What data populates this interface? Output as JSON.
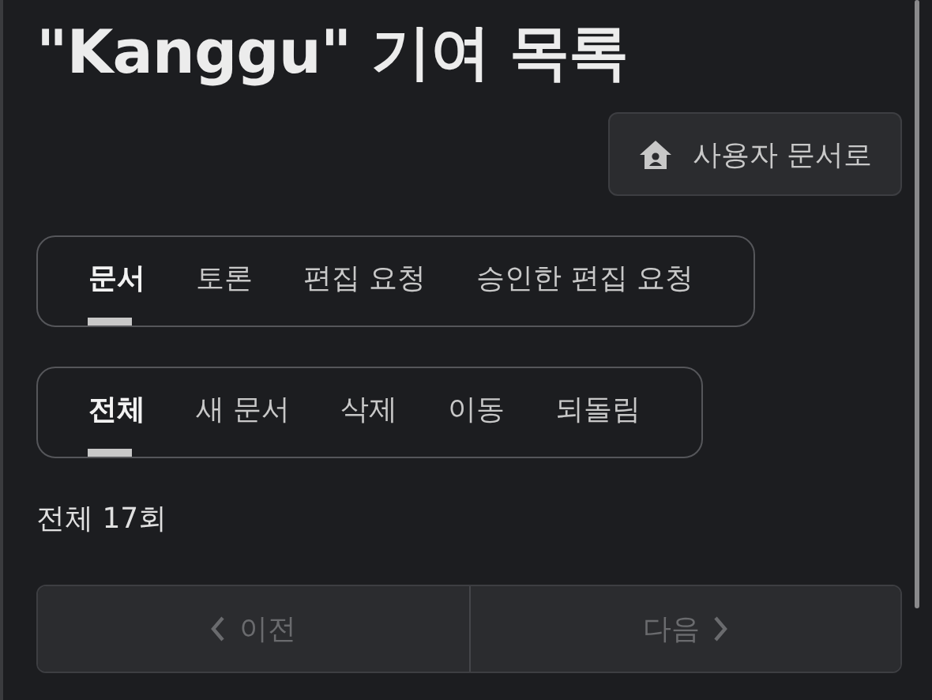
{
  "title": "\"Kanggu\" 기여 목록",
  "user_doc_button": {
    "label": "사용자 문서로"
  },
  "namespace_tabs": [
    {
      "label": "문서",
      "selected": true
    },
    {
      "label": "토론",
      "selected": false
    },
    {
      "label": "편집 요청",
      "selected": false
    },
    {
      "label": "승인한 편집 요청",
      "selected": false
    }
  ],
  "type_tabs": [
    {
      "label": "전체",
      "selected": true
    },
    {
      "label": "새 문서",
      "selected": false
    },
    {
      "label": "삭제",
      "selected": false
    },
    {
      "label": "이동",
      "selected": false
    },
    {
      "label": "되돌림",
      "selected": false
    }
  ],
  "count": "전체 17회",
  "pagination": [
    {
      "kind": "prev",
      "label": "이전",
      "disabled": true
    },
    {
      "kind": "next",
      "label": "다음",
      "disabled": true
    }
  ]
}
